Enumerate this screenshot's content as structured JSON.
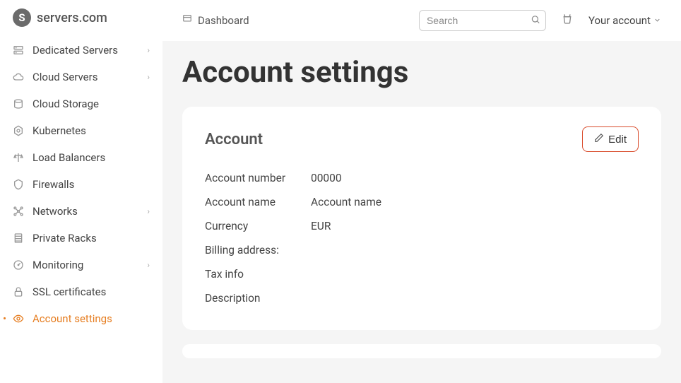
{
  "brand": {
    "name": "servers.com"
  },
  "sidebar": {
    "items": [
      {
        "label": "Dedicated Servers",
        "icon": "server",
        "chevron": true
      },
      {
        "label": "Cloud Servers",
        "icon": "cloud",
        "chevron": true
      },
      {
        "label": "Cloud Storage",
        "icon": "storage",
        "chevron": false
      },
      {
        "label": "Kubernetes",
        "icon": "kube",
        "chevron": false
      },
      {
        "label": "Load Balancers",
        "icon": "scale",
        "chevron": false
      },
      {
        "label": "Firewalls",
        "icon": "shield",
        "chevron": false
      },
      {
        "label": "Networks",
        "icon": "network",
        "chevron": true
      },
      {
        "label": "Private Racks",
        "icon": "rack",
        "chevron": false
      },
      {
        "label": "Monitoring",
        "icon": "gauge",
        "chevron": true
      },
      {
        "label": "SSL certificates",
        "icon": "lock",
        "chevron": false
      },
      {
        "label": "Account settings",
        "icon": "eye",
        "chevron": false,
        "active": true
      }
    ]
  },
  "topbar": {
    "breadcrumb": "Dashboard",
    "search_placeholder": "Search",
    "account_label": "Your account"
  },
  "page": {
    "title": "Account settings"
  },
  "account_card": {
    "title": "Account",
    "edit_label": "Edit",
    "fields": [
      {
        "label": "Account number",
        "value": "00000"
      },
      {
        "label": "Account name",
        "value": "Account name"
      },
      {
        "label": "Currency",
        "value": "EUR"
      },
      {
        "label": "Billing address:",
        "value": ""
      },
      {
        "label": "Tax info",
        "value": ""
      },
      {
        "label": "Description",
        "value": ""
      }
    ]
  }
}
